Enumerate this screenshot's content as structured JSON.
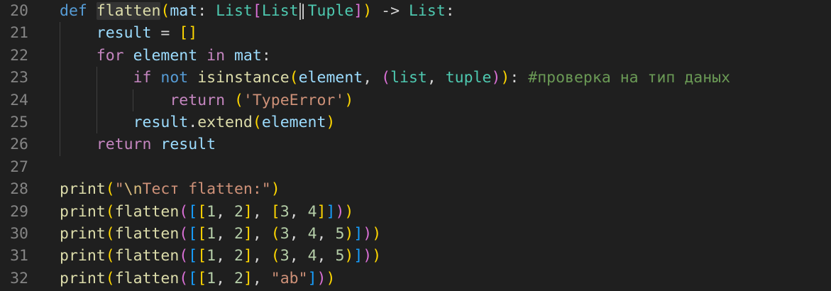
{
  "editor": {
    "lines": [
      {
        "number": "20",
        "tokens": [
          [
            "k",
            "def"
          ],
          [
            "o",
            " "
          ],
          [
            "f hl",
            "flatten"
          ],
          [
            "b1",
            "("
          ],
          [
            "v",
            "mat"
          ],
          [
            "o",
            ": "
          ],
          [
            "t",
            "List"
          ],
          [
            "b2",
            "["
          ],
          [
            "t",
            "List"
          ],
          [
            "o",
            "|"
          ],
          [
            "t",
            "Tuple"
          ],
          [
            "b2",
            "]"
          ],
          [
            "b1",
            ")"
          ],
          [
            "o",
            " -> "
          ],
          [
            "t",
            "List"
          ],
          [
            "o",
            ":"
          ]
        ]
      },
      {
        "number": "21",
        "tokens": [
          [
            "o",
            "    "
          ],
          [
            "v",
            "result"
          ],
          [
            "o",
            " = "
          ],
          [
            "b1",
            "[]"
          ]
        ]
      },
      {
        "number": "22",
        "tokens": [
          [
            "o",
            "    "
          ],
          [
            "c",
            "for"
          ],
          [
            "o",
            " "
          ],
          [
            "v",
            "element"
          ],
          [
            "o",
            " "
          ],
          [
            "c",
            "in"
          ],
          [
            "o",
            " "
          ],
          [
            "v",
            "mat"
          ],
          [
            "o",
            ":"
          ]
        ]
      },
      {
        "number": "23",
        "tokens": [
          [
            "o",
            "        "
          ],
          [
            "c",
            "if"
          ],
          [
            "o",
            " "
          ],
          [
            "k",
            "not"
          ],
          [
            "o",
            " "
          ],
          [
            "f",
            "isinstance"
          ],
          [
            "b1",
            "("
          ],
          [
            "v",
            "element"
          ],
          [
            "o",
            ", "
          ],
          [
            "b2",
            "("
          ],
          [
            "t",
            "list"
          ],
          [
            "o",
            ", "
          ],
          [
            "t",
            "tuple"
          ],
          [
            "b2",
            ")"
          ],
          [
            "b1",
            ")"
          ],
          [
            "o",
            ": "
          ],
          [
            "cm",
            "#проверка на тип даных"
          ]
        ]
      },
      {
        "number": "24",
        "tokens": [
          [
            "o",
            "            "
          ],
          [
            "c",
            "return"
          ],
          [
            "o",
            " "
          ],
          [
            "b1",
            "("
          ],
          [
            "s",
            "'TypeError'"
          ],
          [
            "b1",
            ")"
          ]
        ]
      },
      {
        "number": "25",
        "tokens": [
          [
            "o",
            "        "
          ],
          [
            "v",
            "result"
          ],
          [
            "o",
            "."
          ],
          [
            "f",
            "extend"
          ],
          [
            "b1",
            "("
          ],
          [
            "v",
            "element"
          ],
          [
            "b1",
            ")"
          ]
        ]
      },
      {
        "number": "26",
        "tokens": [
          [
            "o",
            "    "
          ],
          [
            "c",
            "return"
          ],
          [
            "o",
            " "
          ],
          [
            "v",
            "result"
          ]
        ]
      },
      {
        "number": "27",
        "tokens": []
      },
      {
        "number": "28",
        "tokens": [
          [
            "f",
            "print"
          ],
          [
            "b1",
            "("
          ],
          [
            "s",
            "\""
          ],
          [
            "e",
            "\\n"
          ],
          [
            "s",
            "Тест flatten:\""
          ],
          [
            "b1",
            ")"
          ]
        ]
      },
      {
        "number": "29",
        "tokens": [
          [
            "f",
            "print"
          ],
          [
            "b1",
            "("
          ],
          [
            "f",
            "flatten"
          ],
          [
            "b2",
            "("
          ],
          [
            "b3",
            "["
          ],
          [
            "b1",
            "["
          ],
          [
            "n",
            "1"
          ],
          [
            "o",
            ", "
          ],
          [
            "n",
            "2"
          ],
          [
            "b1",
            "]"
          ],
          [
            "o",
            ", "
          ],
          [
            "b1",
            "["
          ],
          [
            "n",
            "3"
          ],
          [
            "o",
            ", "
          ],
          [
            "n",
            "4"
          ],
          [
            "b1",
            "]"
          ],
          [
            "b3",
            "]"
          ],
          [
            "b2",
            ")"
          ],
          [
            "b1",
            ")"
          ]
        ]
      },
      {
        "number": "30",
        "tokens": [
          [
            "f",
            "print"
          ],
          [
            "b1",
            "("
          ],
          [
            "f",
            "flatten"
          ],
          [
            "b2",
            "("
          ],
          [
            "b3",
            "["
          ],
          [
            "b1",
            "["
          ],
          [
            "n",
            "1"
          ],
          [
            "o",
            ", "
          ],
          [
            "n",
            "2"
          ],
          [
            "b1",
            "]"
          ],
          [
            "o",
            ", "
          ],
          [
            "b1",
            "("
          ],
          [
            "n",
            "3"
          ],
          [
            "o",
            ", "
          ],
          [
            "n",
            "4"
          ],
          [
            "o",
            ", "
          ],
          [
            "n",
            "5"
          ],
          [
            "b1",
            ")"
          ],
          [
            "b3",
            "]"
          ],
          [
            "b2",
            ")"
          ],
          [
            "b1",
            ")"
          ]
        ]
      },
      {
        "number": "31",
        "tokens": [
          [
            "f",
            "print"
          ],
          [
            "b1",
            "("
          ],
          [
            "f",
            "flatten"
          ],
          [
            "b2",
            "("
          ],
          [
            "b3",
            "["
          ],
          [
            "b1",
            "["
          ],
          [
            "n",
            "1"
          ],
          [
            "o",
            ", "
          ],
          [
            "n",
            "2"
          ],
          [
            "b1",
            "]"
          ],
          [
            "o",
            ", "
          ],
          [
            "b1",
            "("
          ],
          [
            "n",
            "3"
          ],
          [
            "o",
            ", "
          ],
          [
            "n",
            "4"
          ],
          [
            "o",
            ", "
          ],
          [
            "n",
            "5"
          ],
          [
            "b1",
            ")"
          ],
          [
            "b3",
            "]"
          ],
          [
            "b2",
            ")"
          ],
          [
            "b1",
            ")"
          ]
        ]
      },
      {
        "number": "32",
        "tokens": [
          [
            "f",
            "print"
          ],
          [
            "b1",
            "("
          ],
          [
            "f",
            "flatten"
          ],
          [
            "b2",
            "("
          ],
          [
            "b3",
            "["
          ],
          [
            "b1",
            "["
          ],
          [
            "n",
            "1"
          ],
          [
            "o",
            ", "
          ],
          [
            "n",
            "2"
          ],
          [
            "b1",
            "]"
          ],
          [
            "o",
            ", "
          ],
          [
            "s",
            "\"ab\""
          ],
          [
            "b3",
            "]"
          ],
          [
            "b2",
            ")"
          ],
          [
            "b1",
            ")"
          ]
        ]
      }
    ]
  },
  "colors": {
    "background": "#1f1f1f",
    "line_number": "#858585",
    "keyword": "#569cd6",
    "control": "#c586c0",
    "function": "#dcdcaa",
    "variable": "#9cdcfe",
    "type": "#4ec9b0",
    "string": "#ce9178",
    "number": "#b5cea8",
    "comment": "#6a9955"
  }
}
